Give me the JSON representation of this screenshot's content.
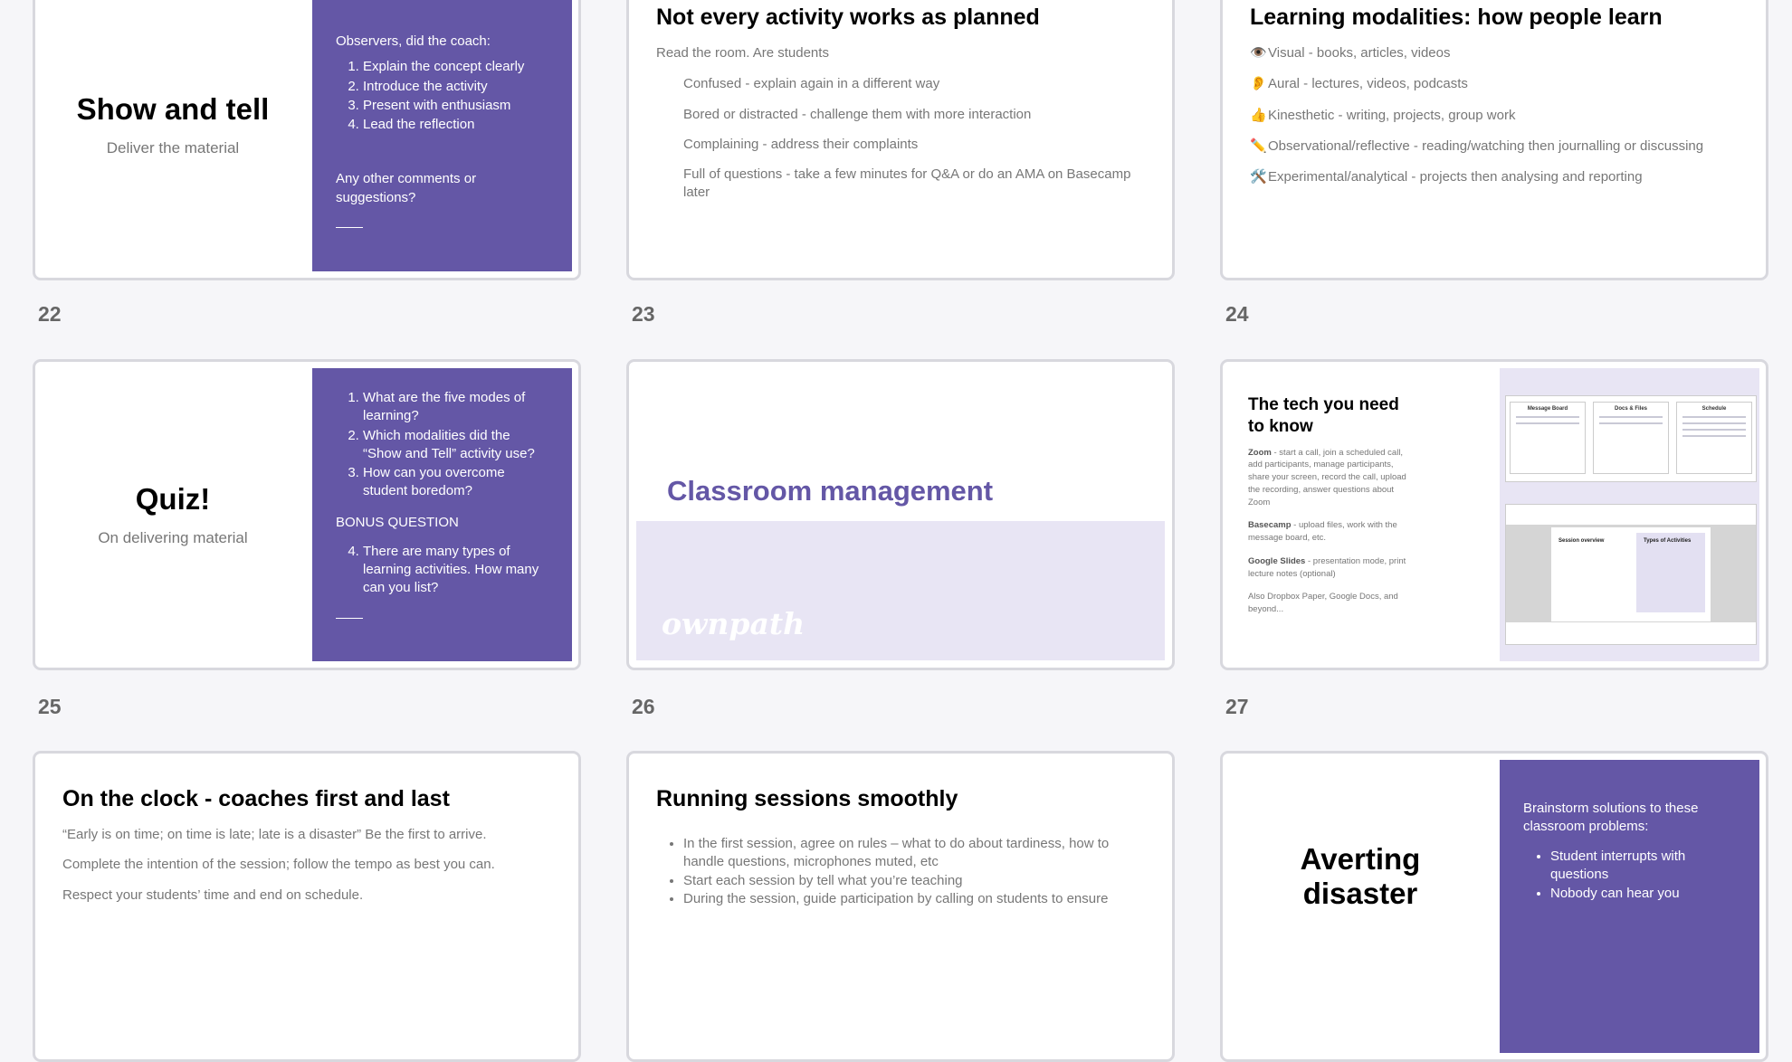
{
  "slides": [
    {
      "number": "22",
      "title": "Show and tell",
      "subtitle": "Deliver the material",
      "panel_intro": "Observers, did the coach:",
      "panel_items": [
        "Explain the concept clearly",
        "Introduce the activity",
        "Present with enthusiasm",
        "Lead the reflection"
      ],
      "panel_outro": "Any other comments or suggestions?"
    },
    {
      "number": "23",
      "title": "Not every activity works as planned",
      "intro": "Read the room. Are students",
      "items": [
        "Confused - explain again in a different way",
        "Bored or distracted - challenge them with more interaction",
        "Complaining - address their complaints",
        "Full of questions - take a few minutes for Q&A or do an AMA on Basecamp later"
      ]
    },
    {
      "number": "24",
      "title": "Learning modalities: how people learn",
      "items": [
        {
          "icon": "👁️",
          "text": "Visual  - books, articles, videos"
        },
        {
          "icon": "👂",
          "text": "Aural - lectures, videos, podcasts"
        },
        {
          "icon": "👍",
          "text": "Kinesthetic - writing, projects, group work"
        },
        {
          "icon": "✏️",
          "text": "Observational/reflective - reading/watching then journalling or discussing"
        },
        {
          "icon": "🛠️",
          "text": "Experimental/analytical - projects then analysing and reporting"
        }
      ]
    },
    {
      "number": "25",
      "title": "Quiz!",
      "subtitle": "On delivering material",
      "questions": [
        "What are the five modes of learning?",
        "Which modalities did the “Show and Tell” activity use?",
        "How can you overcome student boredom?"
      ],
      "bonus_label": "BONUS QUESTION",
      "bonus_question": "There are many types of learning activities. How many can you list?"
    },
    {
      "number": "26",
      "title": "Classroom management",
      "logo": "ownpath"
    },
    {
      "number": "27",
      "title": "The tech you need to know",
      "paragraphs": [
        {
          "lead": "Zoom",
          "text": " - start a call, join a scheduled call, add participants, manage participants, share your screen, record the call, upload the recording, answer questions about Zoom"
        },
        {
          "lead": "Basecamp",
          "text": " - upload files, work with the message board, etc."
        },
        {
          "lead": "Google Slides",
          "text": " - presentation mode, print lecture notes (optional)"
        },
        {
          "lead": "",
          "text": "Also Dropbox Paper, Google Docs, and beyond..."
        }
      ],
      "screenshot_labels": [
        "Message Board",
        "Docs & Files",
        "Schedule"
      ],
      "doc_labels": [
        "Session overview",
        "Types of Activities"
      ]
    },
    {
      "title": "On the clock - coaches first and last",
      "lines": [
        "“Early is on time; on time is late; late is a disaster” Be the first to arrive.",
        "Complete the intention of the session; follow the tempo as best you can.",
        "Respect your students’ time and end on schedule."
      ]
    },
    {
      "title": "Running sessions smoothly",
      "bullets": [
        "In the first session, agree on rules – what to do about tardiness, how to handle questions, microphones muted, etc",
        "Start each session by tell what you’re teaching",
        "During the session, guide participation by calling on students to ensure"
      ]
    },
    {
      "title": "Averting disaster",
      "panel_intro": "Brainstorm solutions to these classroom problems:",
      "panel_items": [
        "Student interrupts with questions",
        "Nobody can hear you"
      ]
    }
  ]
}
